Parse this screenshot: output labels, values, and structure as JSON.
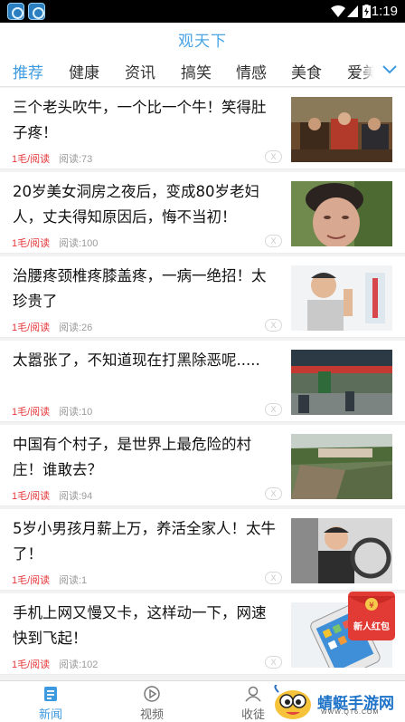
{
  "status_bar": {
    "time": "1:19"
  },
  "header": {
    "title": "观天下"
  },
  "tabs": [
    {
      "label": "推荐",
      "active": true
    },
    {
      "label": "健康"
    },
    {
      "label": "资讯"
    },
    {
      "label": "搞笑"
    },
    {
      "label": "情感"
    },
    {
      "label": "美食"
    },
    {
      "label": "爱美"
    }
  ],
  "news": [
    {
      "title": "三个老头吹牛，一个比一个牛！笑得肚子疼！",
      "price": "1毛/阅读",
      "reads": "阅读:73",
      "close": "X"
    },
    {
      "title": "20岁美女洞房之夜后，变成80岁老妇人，丈夫得知原因后，悔不当初！",
      "price": "1毛/阅读",
      "reads": "阅读:100",
      "close": "X"
    },
    {
      "title": "治腰疼颈椎疼膝盖疼，一病一绝招！太珍贵了",
      "price": "1毛/阅读",
      "reads": "阅读:26",
      "close": "X"
    },
    {
      "title": "太嚣张了，不知道现在打黑除恶呢.....",
      "price": "1毛/阅读",
      "reads": "阅读:10",
      "close": "X"
    },
    {
      "title": "中国有个村子，是世界上最危险的村庄！谁敢去？",
      "price": "1毛/阅读",
      "reads": "阅读:94",
      "close": "X"
    },
    {
      "title": "5岁小男孩月薪上万，养活全家人！太牛了！",
      "price": "1毛/阅读",
      "reads": "阅读:1",
      "close": "X"
    },
    {
      "title": "手机上网又慢又卡，这样动一下，网速快到飞起！",
      "price": "1毛/阅读",
      "reads": "阅读:102",
      "close": "X"
    }
  ],
  "bottom_nav": [
    {
      "label": "新闻",
      "icon": "news-icon",
      "active": true
    },
    {
      "label": "视频",
      "icon": "play-icon"
    },
    {
      "label": "收徒",
      "icon": "users-icon"
    }
  ],
  "red_packet": {
    "label": "新人红包"
  },
  "watermark": {
    "title": "蜻蜓手游网",
    "url": "WWW.QT6.COM"
  },
  "colors": {
    "accent": "#3d9ae0",
    "price_red": "#e5373a",
    "status_bar": "#000000"
  }
}
